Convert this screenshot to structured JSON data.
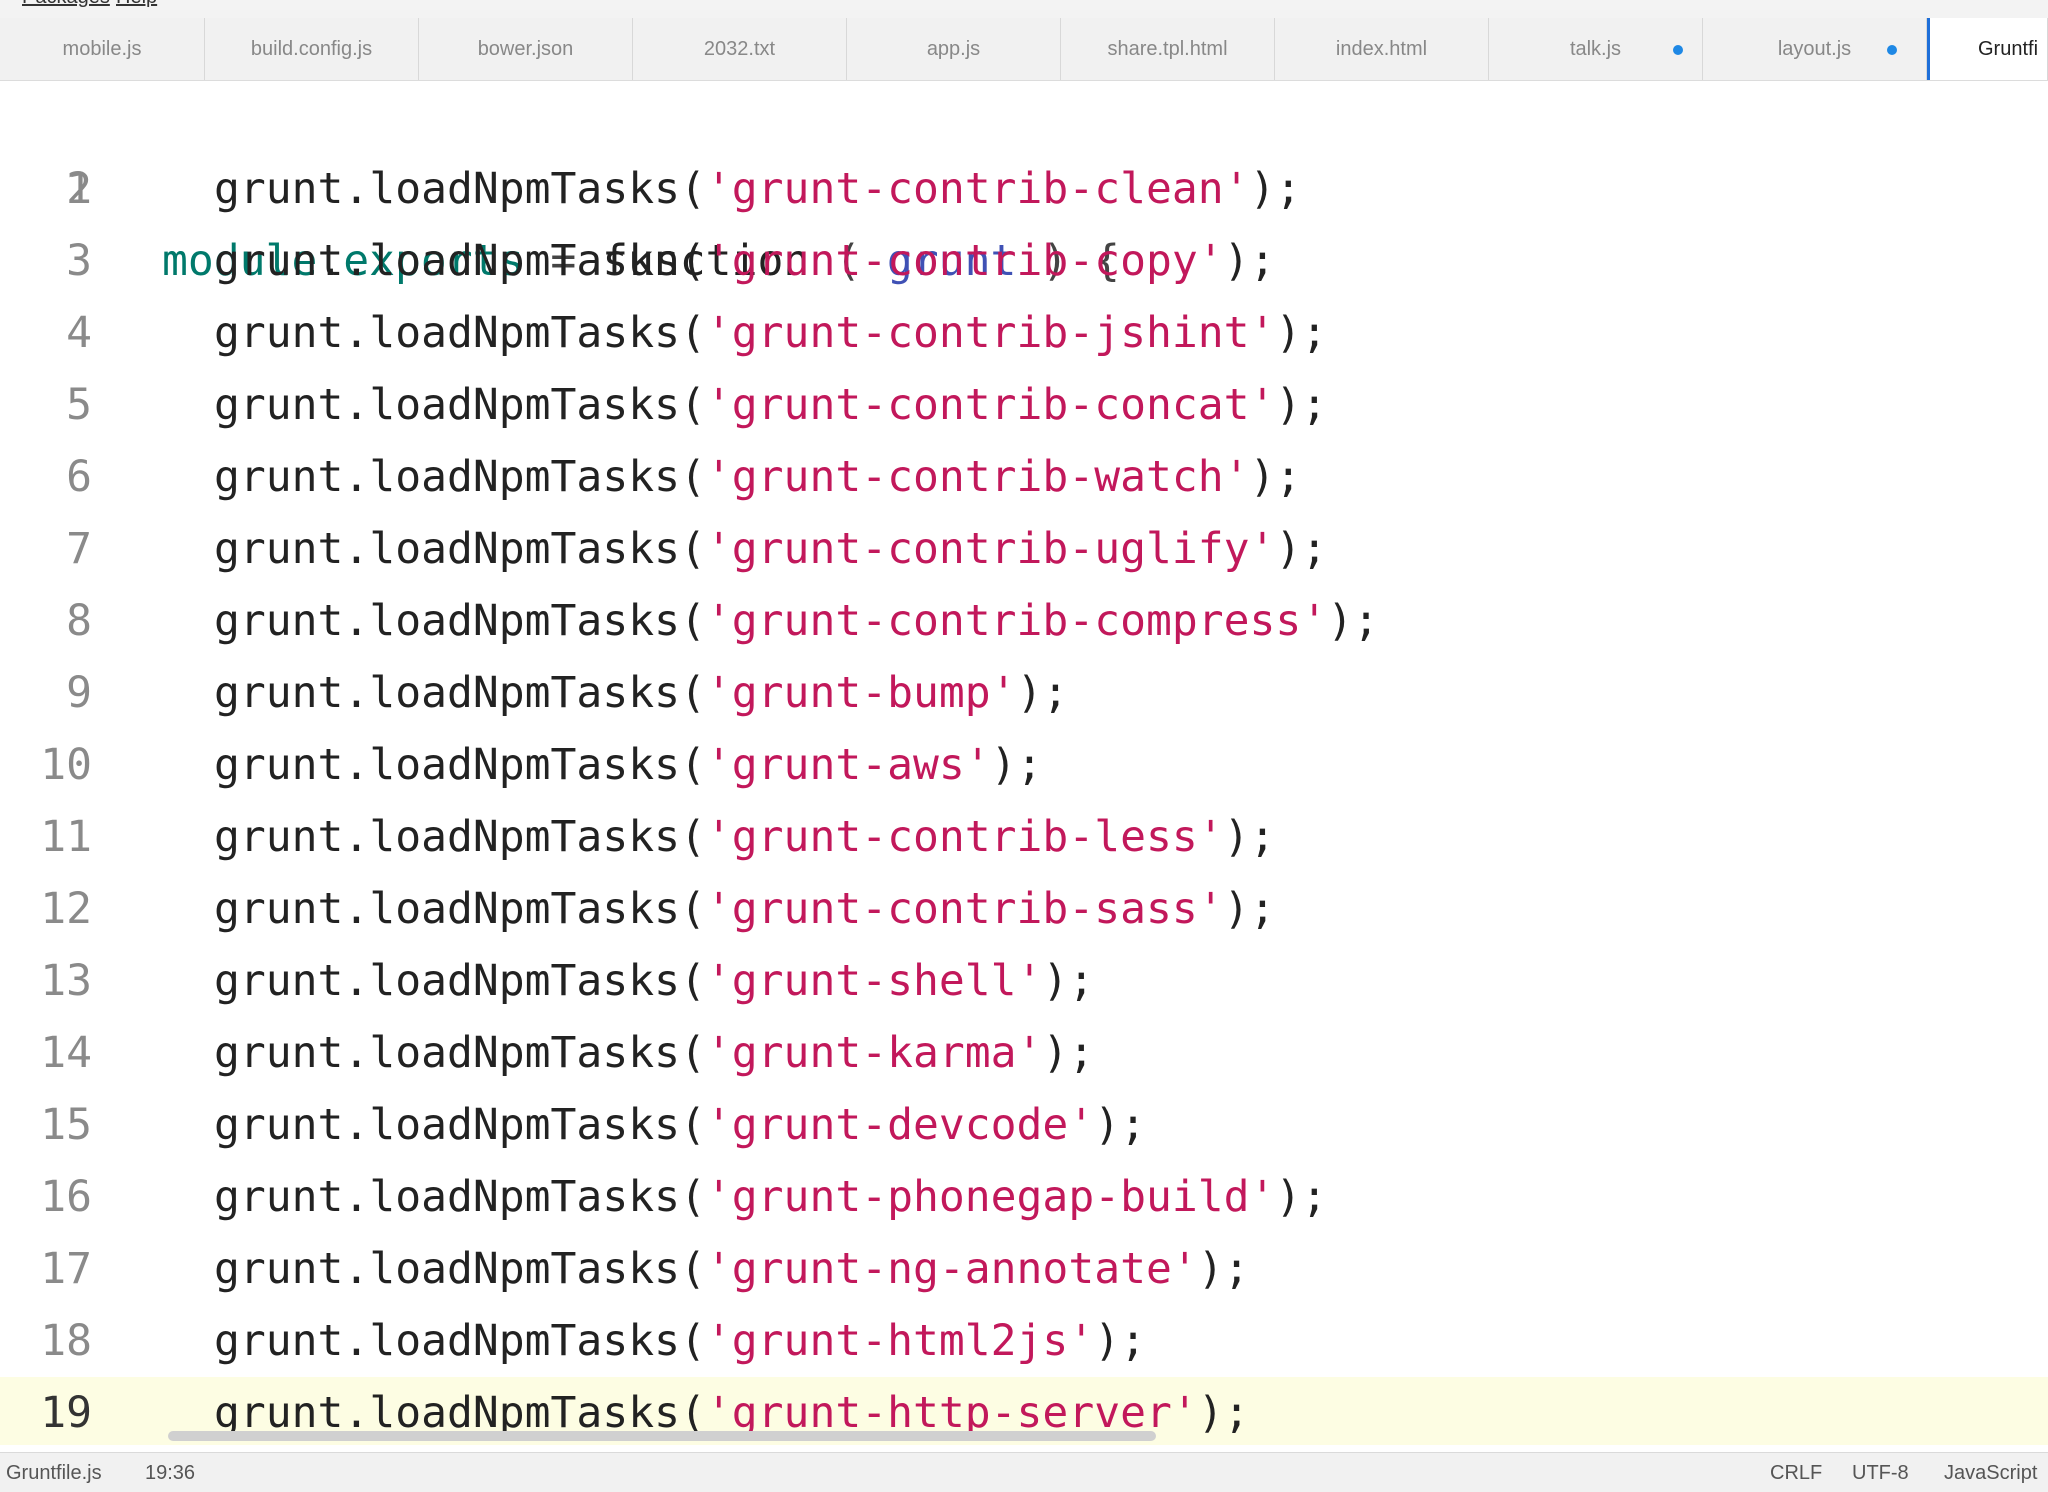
{
  "menubar": {
    "items": [
      "Packages",
      "Help"
    ]
  },
  "tabs": [
    {
      "label": "mobile.js",
      "modified": false,
      "active": false
    },
    {
      "label": "build.config.js",
      "modified": false,
      "active": false
    },
    {
      "label": "bower.json",
      "modified": false,
      "active": false
    },
    {
      "label": "2032.txt",
      "modified": false,
      "active": false
    },
    {
      "label": "app.js",
      "modified": false,
      "active": false
    },
    {
      "label": "share.tpl.html",
      "modified": false,
      "active": false
    },
    {
      "label": "index.html",
      "modified": false,
      "active": false
    },
    {
      "label": "talk.js",
      "modified": true,
      "active": false
    },
    {
      "label": "layout.js",
      "modified": true,
      "active": false
    },
    {
      "label": "Gruntfi",
      "modified": false,
      "active": true
    }
  ],
  "editor": {
    "current_line": 19,
    "lines": [
      {
        "num": "1",
        "text": "module.exports = function ( grunt ) {"
      },
      {
        "num": "2",
        "text": "grunt.loadNpmTasks('grunt-contrib-clean');",
        "pkg": "grunt-contrib-clean"
      },
      {
        "num": "3",
        "text": "grunt.loadNpmTasks('grunt-contrib-copy');",
        "pkg": "grunt-contrib-copy"
      },
      {
        "num": "4",
        "text": "grunt.loadNpmTasks('grunt-contrib-jshint');",
        "pkg": "grunt-contrib-jshint"
      },
      {
        "num": "5",
        "text": "grunt.loadNpmTasks('grunt-contrib-concat');",
        "pkg": "grunt-contrib-concat"
      },
      {
        "num": "6",
        "text": "grunt.loadNpmTasks('grunt-contrib-watch');",
        "pkg": "grunt-contrib-watch"
      },
      {
        "num": "7",
        "text": "grunt.loadNpmTasks('grunt-contrib-uglify');",
        "pkg": "grunt-contrib-uglify"
      },
      {
        "num": "8",
        "text": "grunt.loadNpmTasks('grunt-contrib-compress');",
        "pkg": "grunt-contrib-compress"
      },
      {
        "num": "9",
        "text": "grunt.loadNpmTasks('grunt-bump');",
        "pkg": "grunt-bump"
      },
      {
        "num": "10",
        "text": "grunt.loadNpmTasks('grunt-aws');",
        "pkg": "grunt-aws"
      },
      {
        "num": "11",
        "text": "grunt.loadNpmTasks('grunt-contrib-less');",
        "pkg": "grunt-contrib-less"
      },
      {
        "num": "12",
        "text": "grunt.loadNpmTasks('grunt-contrib-sass');",
        "pkg": "grunt-contrib-sass"
      },
      {
        "num": "13",
        "text": "grunt.loadNpmTasks('grunt-shell');",
        "pkg": "grunt-shell"
      },
      {
        "num": "14",
        "text": "grunt.loadNpmTasks('grunt-karma');",
        "pkg": "grunt-karma"
      },
      {
        "num": "15",
        "text": "grunt.loadNpmTasks('grunt-devcode');",
        "pkg": "grunt-devcode"
      },
      {
        "num": "16",
        "text": "grunt.loadNpmTasks('grunt-phonegap-build');",
        "pkg": "grunt-phonegap-build"
      },
      {
        "num": "17",
        "text": "grunt.loadNpmTasks('grunt-ng-annotate');",
        "pkg": "grunt-ng-annotate"
      },
      {
        "num": "18",
        "text": "grunt.loadNpmTasks('grunt-html2js');",
        "pkg": "grunt-html2js"
      },
      {
        "num": "19",
        "text": "grunt.loadNpmTasks('grunt-http-server');",
        "pkg": "grunt-http-server"
      }
    ]
  },
  "statusbar": {
    "file": "Gruntfile.js",
    "cursor": "19:36",
    "line_ending": "CRLF",
    "encoding": "UTF-8",
    "grammar": "JavaScript"
  },
  "colors": {
    "keyword": "#00796b",
    "string": "#c2185b",
    "param": "#3f51b5",
    "modified_dot": "#1e88e5",
    "active_tab_border": "#1e6fd9",
    "current_line_bg": "#fdfde3"
  }
}
